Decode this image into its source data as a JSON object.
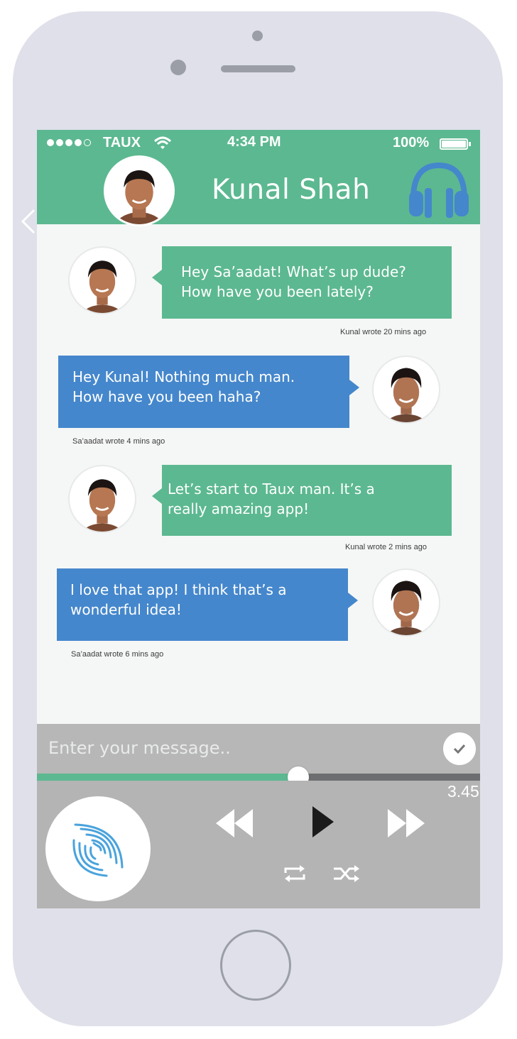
{
  "status_bar": {
    "carrier": "TAUX",
    "time": "4:34 PM",
    "battery": "100%",
    "signal_strength": 4
  },
  "header": {
    "contact_name": "Kunal Shah",
    "icon": "headphones-icon"
  },
  "messages": [
    {
      "sender": "Kunal",
      "side": "left",
      "color": "#5cb890",
      "lines": [
        "Hey Sa’aadat! What’s up dude?",
        "How have you been lately?"
      ],
      "meta": "Kunal wrote 20 mins ago"
    },
    {
      "sender": "Sa'aadat",
      "side": "right",
      "color": "#4587cc",
      "lines": [
        "Hey Kunal! Nothing much man.",
        "How have you been haha?"
      ],
      "meta": "Sa’aadat wrote 4 mins ago"
    },
    {
      "sender": "Kunal",
      "side": "left",
      "color": "#5cb890",
      "lines": [
        "Let’s start to Taux man. It’s a",
        "really amazing app!"
      ],
      "meta": "Kunal wrote 2 mins ago"
    },
    {
      "sender": "Sa'aadat",
      "side": "right",
      "color": "#4587cc",
      "lines": [
        "I love that app! I think that’s a",
        "wonderful idea!"
      ],
      "meta": "Sa’aadat wrote 6 mins ago"
    }
  ],
  "composer": {
    "placeholder": "Enter your message..",
    "send_icon": "checkmark-icon"
  },
  "player": {
    "progress": 0.59,
    "time": "3.45",
    "controls": [
      "rewind-icon",
      "play-icon",
      "fast-forward-icon",
      "repeat-icon",
      "shuffle-icon"
    ]
  },
  "colors": {
    "accent_green": "#5cb890",
    "accent_blue": "#4587cc",
    "frame": "#dfe0e9"
  }
}
